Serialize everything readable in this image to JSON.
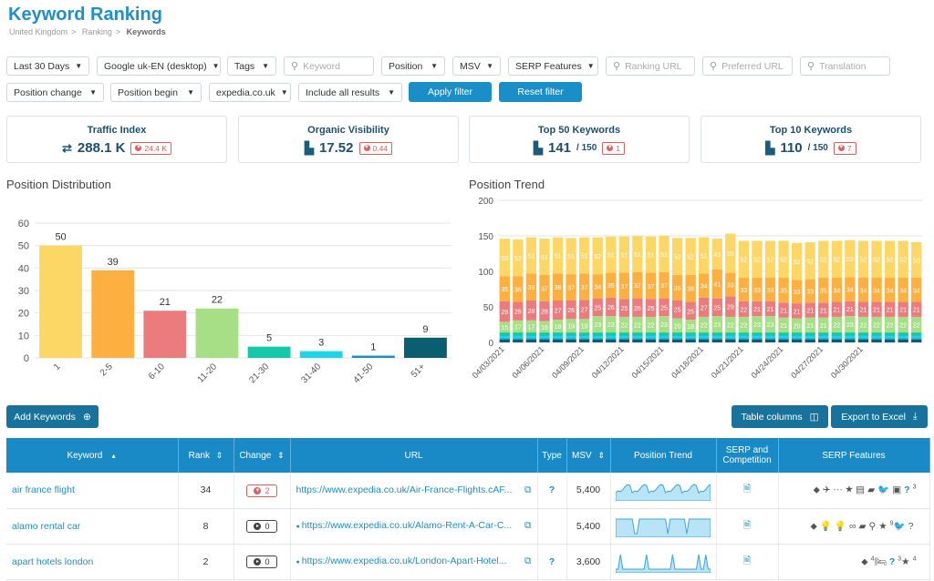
{
  "header": {
    "title": "Keyword Ranking",
    "breadcrumb": [
      "United Kingdom",
      "Ranking",
      "Keywords"
    ]
  },
  "filters": {
    "row1": [
      {
        "label": "Last 30 Days",
        "kind": "select"
      },
      {
        "label": "Google uk-EN (desktop)",
        "kind": "select"
      },
      {
        "label": "Tags",
        "kind": "select"
      },
      {
        "label": "Keyword",
        "kind": "input"
      },
      {
        "label": "Position",
        "kind": "select"
      },
      {
        "label": "MSV",
        "kind": "select"
      },
      {
        "label": "SERP Features",
        "kind": "select"
      },
      {
        "label": "Ranking URL",
        "kind": "input"
      },
      {
        "label": "Preferred URL",
        "kind": "input"
      },
      {
        "label": "Translation",
        "kind": "input"
      }
    ],
    "row2": [
      {
        "label": "Position change",
        "kind": "select"
      },
      {
        "label": "Position begin",
        "kind": "select"
      },
      {
        "label": "expedia.co.uk",
        "kind": "select"
      },
      {
        "label": "Include all results",
        "kind": "select"
      }
    ],
    "apply_label": "Apply filter",
    "reset_label": "Reset filter"
  },
  "cards": [
    {
      "title": "Traffic Index",
      "icon": "swap-icon",
      "value": "288.1 K",
      "denominator": "",
      "badge": "24.4 K"
    },
    {
      "title": "Organic Visibility",
      "icon": "bar-chart-icon",
      "value": "17.52",
      "denominator": "",
      "badge": "0.44"
    },
    {
      "title": "Top 50 Keywords",
      "icon": "bar-chart-icon",
      "value": "141",
      "denominator": "/ 150",
      "badge": "1"
    },
    {
      "title": "Top 10 Keywords",
      "icon": "bar-chart-icon",
      "value": "110",
      "denominator": "/ 150",
      "badge": "7"
    }
  ],
  "sections": {
    "distribution_title": "Position Distribution",
    "trend_title": "Position Trend"
  },
  "chart_data": [
    {
      "type": "bar",
      "title": "Position Distribution",
      "categories": [
        "1",
        "2-5",
        "6-10",
        "11-20",
        "21-30",
        "31-40",
        "41-50",
        "51+"
      ],
      "values": [
        50,
        39,
        21,
        22,
        5,
        3,
        1,
        9
      ],
      "colors": [
        "#fdd766",
        "#fdb03f",
        "#ec7b7e",
        "#a7df86",
        "#13c9a8",
        "#1bd5ef",
        "#1a8fc7",
        "#0b5e6f"
      ],
      "ylim": [
        0,
        60
      ],
      "yticks": [
        0,
        10,
        20,
        30,
        40,
        50,
        60
      ],
      "grid": true
    },
    {
      "type": "bar",
      "stacked": true,
      "title": "Position Trend",
      "x_labels": [
        "04/03/2021",
        "04/06/2021",
        "04/09/2021",
        "04/12/2021",
        "04/15/2021",
        "04/18/2021",
        "04/21/2021",
        "04/24/2021",
        "04/27/2021",
        "04/30/2021"
      ],
      "ylim": [
        0,
        200
      ],
      "yticks": [
        0,
        50,
        100,
        150,
        200
      ],
      "series": [
        {
          "color": "#0b5e6f",
          "values": [
            4,
            4,
            4,
            4,
            4,
            4,
            4,
            4,
            4,
            4,
            4,
            4,
            4,
            4,
            4,
            4,
            4,
            4,
            4,
            4,
            4,
            4,
            4,
            4,
            4,
            4,
            4,
            4,
            4,
            4,
            4,
            4
          ]
        },
        {
          "color": "#1a8fc7",
          "values": [
            2,
            2,
            2,
            2,
            2,
            2,
            2,
            2,
            2,
            2,
            2,
            2,
            2,
            2,
            2,
            2,
            2,
            2,
            2,
            2,
            2,
            2,
            2,
            2,
            2,
            2,
            2,
            2,
            2,
            2,
            2,
            2
          ]
        },
        {
          "color": "#1bd5ef",
          "values": [
            3,
            3,
            3,
            3,
            3,
            3,
            3,
            3,
            3,
            3,
            3,
            3,
            3,
            3,
            3,
            3,
            3,
            3,
            3,
            3,
            3,
            3,
            3,
            3,
            3,
            3,
            3,
            3,
            3,
            3,
            3,
            3
          ]
        },
        {
          "color": "#13c9a8",
          "values": [
            5,
            5,
            5,
            5,
            5,
            5,
            5,
            5,
            5,
            5,
            5,
            5,
            5,
            5,
            5,
            5,
            5,
            5,
            5,
            5,
            5,
            5,
            5,
            5,
            5,
            5,
            5,
            5,
            5,
            5,
            5,
            5
          ]
        },
        {
          "color": "#a7df86",
          "values": [
            15,
            17,
            17,
            16,
            18,
            19,
            19,
            23,
            23,
            22,
            22,
            22,
            23,
            20,
            18,
            22,
            23,
            22,
            22,
            23,
            23,
            21,
            20,
            21,
            21,
            22,
            23,
            22,
            22,
            22,
            22,
            22
          ]
        },
        {
          "color": "#ec7b7e",
          "values": [
            29,
            26,
            28,
            28,
            27,
            26,
            27,
            25,
            26,
            25,
            26,
            25,
            25,
            25,
            25,
            27,
            25,
            29,
            22,
            21,
            21,
            21,
            21,
            21,
            21,
            21,
            21,
            21,
            21,
            21,
            21,
            21
          ]
        },
        {
          "color": "#fdb03f",
          "values": [
            35,
            36,
            38,
            37,
            38,
            37,
            37,
            34,
            35,
            37,
            37,
            37,
            37,
            36,
            38,
            34,
            41,
            33,
            33,
            33,
            33,
            35,
            33,
            33,
            35,
            34,
            34,
            34,
            34,
            34,
            34,
            34
          ]
        },
        {
          "color": "#fdd766",
          "values": [
            53,
            52,
            51,
            51,
            51,
            51,
            51,
            52,
            51,
            51,
            51,
            51,
            51,
            52,
            52,
            51,
            43,
            55,
            52,
            52,
            52,
            52,
            52,
            52,
            52,
            52,
            52,
            52,
            52,
            52,
            52,
            50
          ]
        }
      ]
    }
  ],
  "toolbar": {
    "add_keywords": "Add Keywords",
    "table_columns": "Table columns",
    "export_excel": "Export to Excel"
  },
  "table": {
    "headers": [
      "Keyword",
      "Rank",
      "Change",
      "URL",
      "Type",
      "MSV",
      "Position Trend",
      "SERP and Competition",
      "SERP Features"
    ],
    "rows": [
      {
        "keyword": "air france flight",
        "rank": "34",
        "change": "2",
        "change_negative": true,
        "url": "https://www.expedia.co.uk/Air-France-Flights.cAF...",
        "type": "?",
        "msv": "5,400",
        "serp_sup1": "3",
        "serp_sup2": ""
      },
      {
        "keyword": "alamo rental car",
        "rank": "8",
        "change": "0",
        "change_negative": false,
        "url": "https://www.expedia.co.uk/Alamo-Rent-A-Car-C...",
        "type": "",
        "msv": "5,400",
        "serp_sup1": "9",
        "serp_sup2": ""
      },
      {
        "keyword": "apart hotels london",
        "rank": "2",
        "change": "0",
        "change_negative": false,
        "url": "https://www.expedia.co.uk/London-Apart-Hotel...",
        "type": "?",
        "msv": "3,600",
        "serp_sup1": "4",
        "serp_sup2": "3",
        "serp_sup3": "4"
      }
    ]
  }
}
